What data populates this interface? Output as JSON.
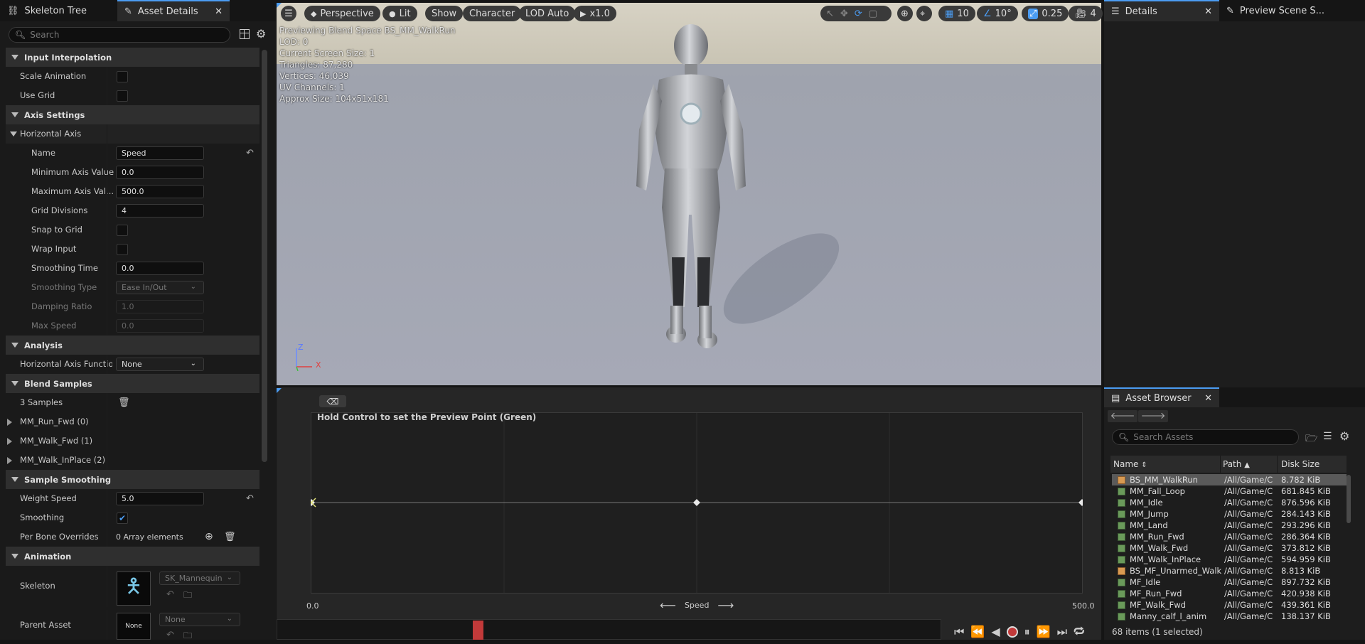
{
  "tabs": {
    "skeleton_tree": "Skeleton Tree",
    "asset_details": "Asset Details",
    "details": "Details",
    "preview_scene": "Preview Scene S..."
  },
  "search": {
    "placeholder": "Search"
  },
  "details": {
    "input_interpolation": "Input Interpolation",
    "scale_animation": "Scale Animation",
    "use_grid": "Use Grid",
    "axis_settings": "Axis Settings",
    "horizontal_axis": "Horizontal Axis",
    "name_label": "Name",
    "name_value": "Speed",
    "min_axis_label": "Minimum Axis Value",
    "min_axis_value": "0.0",
    "max_axis_label": "Maximum Axis Val...",
    "max_axis_value": "500.0",
    "grid_div_label": "Grid Divisions",
    "grid_div_value": "4",
    "snap_label": "Snap to Grid",
    "wrap_label": "Wrap Input",
    "smooth_time_label": "Smoothing Time",
    "smooth_time_value": "0.0",
    "smooth_type_label": "Smoothing Type",
    "smooth_type_value": "Ease In/Out",
    "damping_label": "Damping Ratio",
    "damping_value": "1.0",
    "max_speed_label": "Max Speed",
    "max_speed_value": "0.0",
    "analysis": "Analysis",
    "haf_label": "Horizontal Axis Functior",
    "haf_value": "None",
    "blend_samples": "Blend Samples",
    "samples_count": "3 Samples",
    "sample_0": "MM_Run_Fwd (0)",
    "sample_1": "MM_Walk_Fwd (1)",
    "sample_2": "MM_Walk_InPlace (2)",
    "sample_smoothing": "Sample Smoothing",
    "weight_speed_label": "Weight Speed",
    "weight_speed_value": "5.0",
    "smoothing_label": "Smoothing",
    "per_bone_label": "Per Bone Overrides",
    "per_bone_value": "0 Array elements",
    "animation": "Animation",
    "skeleton_label": "Skeleton",
    "skeleton_value": "SK_Mannequin",
    "parent_asset_label": "Parent Asset",
    "parent_asset_value": "None",
    "parent_thumb": "None"
  },
  "viewport": {
    "perspective": "Perspective",
    "lit": "Lit",
    "show": "Show",
    "character": "Character",
    "lod": "LOD Auto",
    "speed": "x1.0",
    "grid_snap": "10",
    "rot_snap": "10°",
    "scale_snap": "0.25",
    "cam_speed": "4",
    "overlay": [
      "Previewing Blend Space BS_MM_WalkRun",
      "LOD: 0",
      "Current Screen Size: 1",
      "Triangles: 87,280",
      "Vertices: 46,039",
      "UV Channels: 1",
      "Approx Size: 104x51x181"
    ],
    "axis_z": "Z",
    "axis_x": "X"
  },
  "blend_editor": {
    "hint": "Hold Control to set the Preview Point (Green)",
    "axis_min": "0.0",
    "axis_max": "500.0",
    "axis_name": "Speed",
    "sample_positions": [
      0,
      250,
      500
    ],
    "preview_point": 0
  },
  "asset_browser": {
    "title": "Asset Browser",
    "search_placeholder": "Search Assets",
    "col_name": "Name",
    "col_path": "Path",
    "col_size": "Disk Size",
    "items": [
      {
        "name": "BS_MM_WalkRun",
        "path": "/All/Game/C",
        "size": "8.782 KiB",
        "type": "bs"
      },
      {
        "name": "MM_Fall_Loop",
        "path": "/All/Game/C",
        "size": "681.845 KiB",
        "type": "anim"
      },
      {
        "name": "MM_Idle",
        "path": "/All/Game/C",
        "size": "876.596 KiB",
        "type": "anim"
      },
      {
        "name": "MM_Jump",
        "path": "/All/Game/C",
        "size": "284.143 KiB",
        "type": "anim"
      },
      {
        "name": "MM_Land",
        "path": "/All/Game/C",
        "size": "293.296 KiB",
        "type": "anim"
      },
      {
        "name": "MM_Run_Fwd",
        "path": "/All/Game/C",
        "size": "286.364 KiB",
        "type": "anim"
      },
      {
        "name": "MM_Walk_Fwd",
        "path": "/All/Game/C",
        "size": "373.812 KiB",
        "type": "anim"
      },
      {
        "name": "MM_Walk_InPlace",
        "path": "/All/Game/C",
        "size": "594.959 KiB",
        "type": "anim"
      },
      {
        "name": "BS_MF_Unarmed_Walk",
        "path": "/All/Game/C",
        "size": "8.813 KiB",
        "type": "bs"
      },
      {
        "name": "MF_Idle",
        "path": "/All/Game/C",
        "size": "897.732 KiB",
        "type": "anim"
      },
      {
        "name": "MF_Run_Fwd",
        "path": "/All/Game/C",
        "size": "420.938 KiB",
        "type": "anim"
      },
      {
        "name": "MF_Walk_Fwd",
        "path": "/All/Game/C",
        "size": "439.361 KiB",
        "type": "anim"
      },
      {
        "name": "Manny_calf_l_anim",
        "path": "/All/Game/C",
        "size": "138.137 KiB",
        "type": "anim"
      }
    ],
    "status": "68 items (1 selected)"
  },
  "colors": {
    "accent": "#4b9cf2",
    "record": "#c23a3a"
  }
}
